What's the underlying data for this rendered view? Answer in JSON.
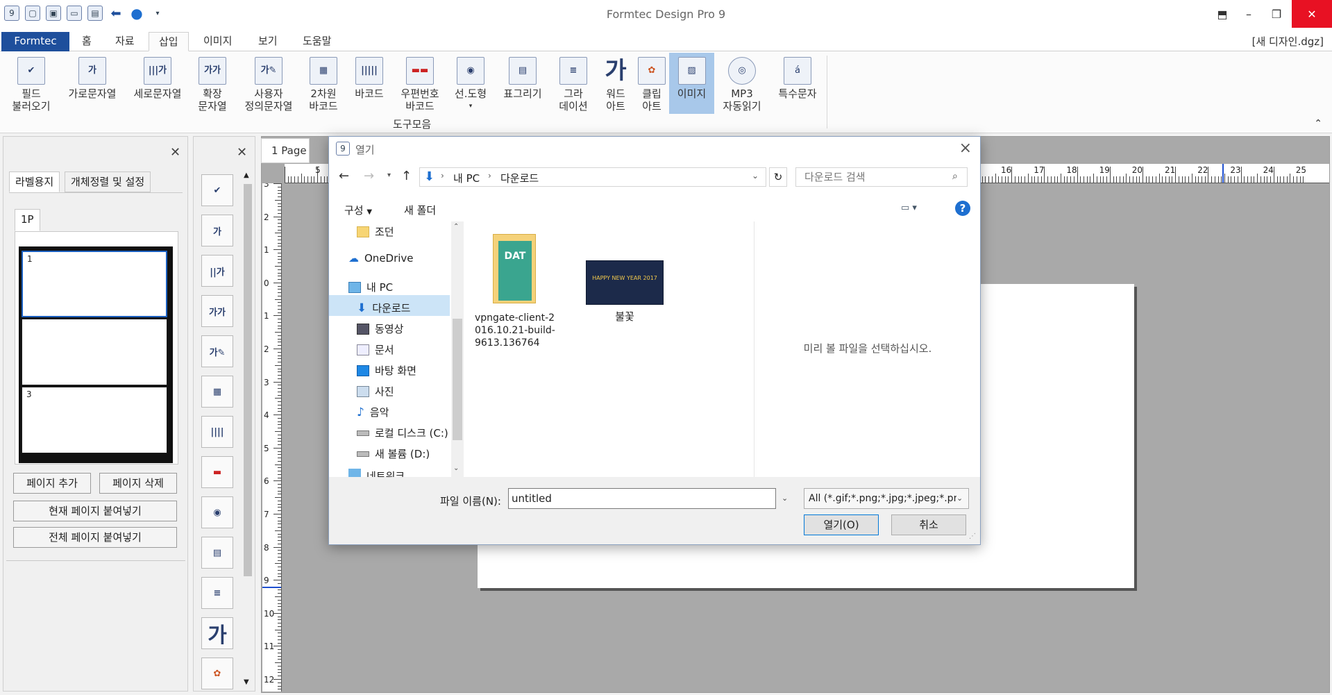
{
  "window": {
    "title": "Formtec Design Pro 9",
    "document": "[새 디자인.dgz]"
  },
  "tabs": [
    "Formtec",
    "홈",
    "자료",
    "삽입",
    "이미지",
    "보기",
    "도움말"
  ],
  "ribbon": {
    "buttons": [
      {
        "label1": "필드",
        "label2": "불러오기",
        "icon": "field-load-icon"
      },
      {
        "label1": "가로문자열",
        "label2": "",
        "icon": "horizontal-text-icon"
      },
      {
        "label1": "세로문자열",
        "label2": "",
        "icon": "vertical-text-icon"
      },
      {
        "label1": "확장",
        "label2": "문자열",
        "icon": "extended-text-icon"
      },
      {
        "label1": "사용자",
        "label2": "정의문자열",
        "icon": "user-text-icon"
      },
      {
        "label1": "2차원",
        "label2": "바코드",
        "icon": "qr-code-icon"
      },
      {
        "label1": "바코드",
        "label2": "",
        "icon": "barcode-icon"
      },
      {
        "label1": "우편번호",
        "label2": "바코드",
        "icon": "postal-barcode-icon"
      },
      {
        "label1": "선.도형",
        "label2": "",
        "icon": "shape-icon"
      },
      {
        "label1": "표그리기",
        "label2": "",
        "icon": "table-icon"
      },
      {
        "label1": "그라",
        "label2": "데이션",
        "icon": "gradient-icon"
      },
      {
        "label1": "워드",
        "label2": "아트",
        "icon": "wordart-icon"
      },
      {
        "label1": "클립",
        "label2": "아트",
        "icon": "clipart-icon"
      },
      {
        "label1": "이미지",
        "label2": "",
        "icon": "image-icon"
      },
      {
        "label1": "MP3",
        "label2": "자동읽기",
        "icon": "mp3-icon"
      },
      {
        "label1": "특수문자",
        "label2": "",
        "icon": "special-char-icon"
      }
    ],
    "group_label": "도구모음"
  },
  "left_panel": {
    "tabs": [
      "라벨용지",
      "개체정렬 및 설정"
    ],
    "page_tab": "1P",
    "cells": [
      "1",
      "",
      "3"
    ],
    "add_page": "페이지 추가",
    "delete_page": "페이지 삭제",
    "paste_current": "현재 페이지 붙여넣기",
    "paste_all": "전체 페이지 붙여넣기"
  },
  "canvas": {
    "page_tab": "1 Page",
    "h_ruler_left": [
      "5"
    ],
    "h_ruler_right": [
      "16",
      "17",
      "18",
      "19",
      "20",
      "21",
      "22",
      "23",
      "24",
      "25"
    ],
    "v_ruler": [
      "3",
      "2",
      "1",
      "0",
      "1",
      "2",
      "3",
      "4",
      "5",
      "6",
      "7",
      "8",
      "9",
      "10",
      "11",
      "12"
    ]
  },
  "dialog": {
    "title": "열기",
    "breadcrumb": [
      "내 PC",
      "다운로드"
    ],
    "search_placeholder": "다운로드 검색",
    "organize": "구성",
    "new_folder": "새 폴더",
    "nav_items": [
      {
        "label": "조던",
        "icon": "folder-icon"
      },
      {
        "label": "OneDrive",
        "icon": "onedrive-icon"
      },
      {
        "label": "내 PC",
        "icon": "pc-icon"
      },
      {
        "label": "다운로드",
        "icon": "download-icon"
      },
      {
        "label": "동영상",
        "icon": "video-icon"
      },
      {
        "label": "문서",
        "icon": "document-icon"
      },
      {
        "label": "바탕 화면",
        "icon": "desktop-icon"
      },
      {
        "label": "사진",
        "icon": "pictures-icon"
      },
      {
        "label": "음악",
        "icon": "music-icon"
      },
      {
        "label": "로컬 디스크 (C:)",
        "icon": "drive-icon"
      },
      {
        "label": "새 볼륨 (D:)",
        "icon": "drive-icon"
      },
      {
        "label": "네트워크",
        "icon": "network-icon"
      }
    ],
    "files": [
      {
        "name": "vpngate-client-2\n016.10.21-build-\n9613.136764",
        "icon": "folder-icon"
      },
      {
        "name": "불꽃",
        "icon": "image-thumbnail"
      }
    ],
    "thumbnail_text": "HAPPY NEW YEAR 2017",
    "folder_badge": "DAT",
    "preview_text": "미리 볼 파일을 선택하십시오.",
    "filename_label": "파일 이름(N):",
    "filename_value": "untitled",
    "filter_value": "All (*.gif;*.png;*.jpg;*.jpeg;*.pn",
    "open_button": "열기(O)",
    "cancel_button": "취소"
  }
}
